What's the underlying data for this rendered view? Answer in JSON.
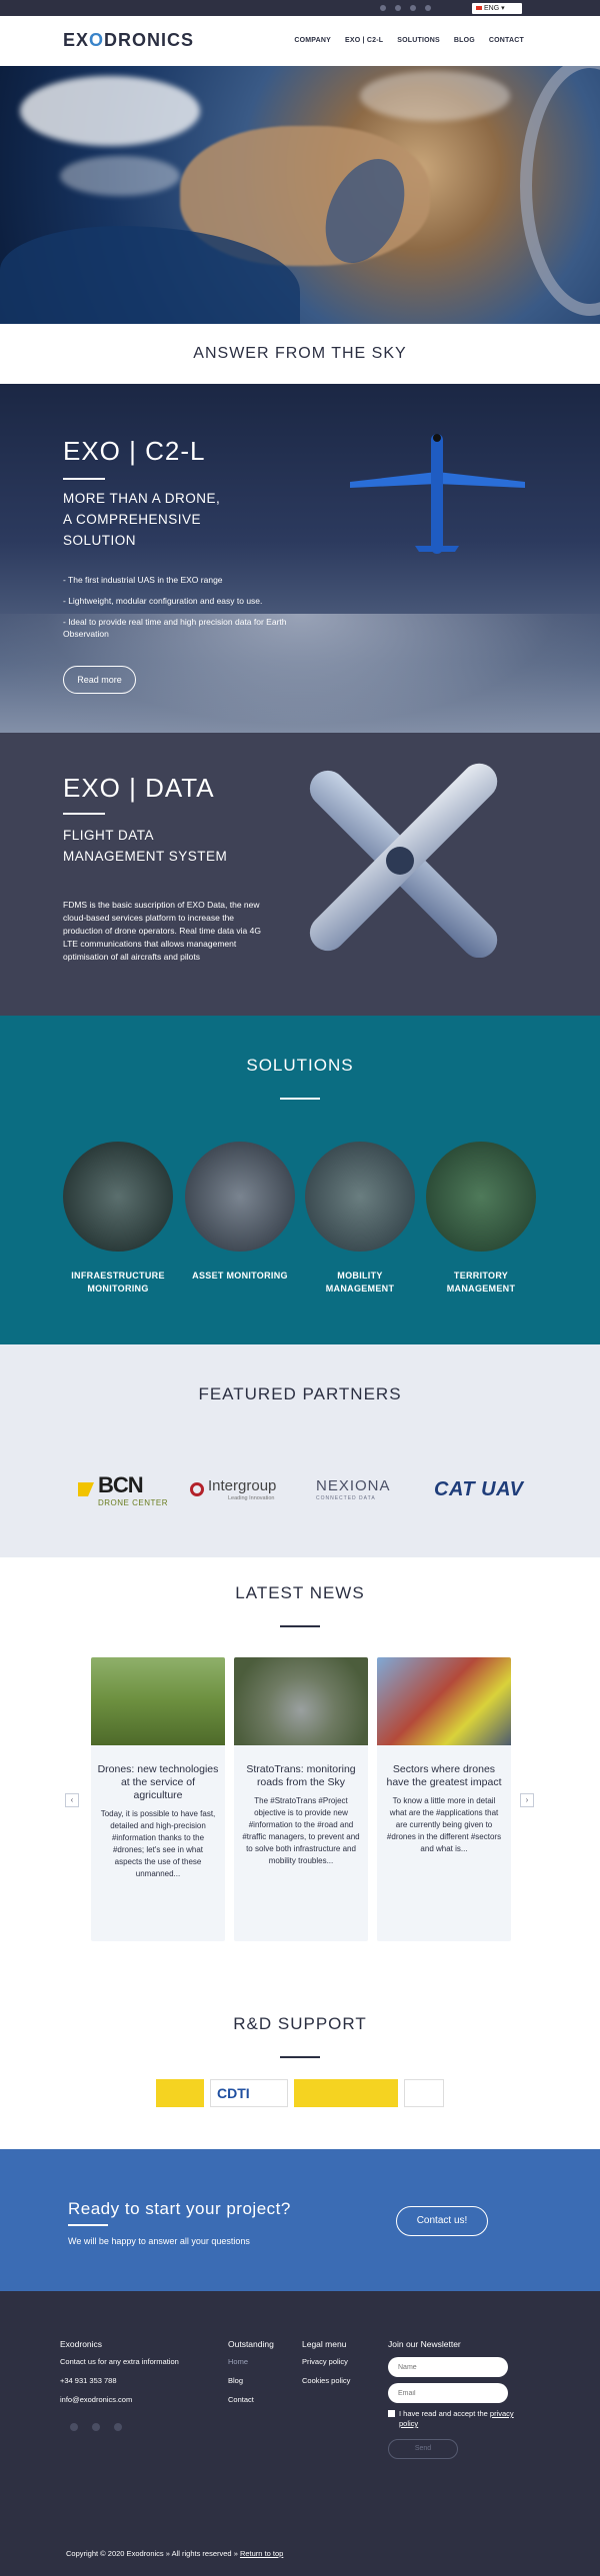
{
  "topbar": {
    "language": "ENG"
  },
  "header": {
    "logo": {
      "prefix": "EX",
      "o": "O",
      "suffix": "DRONICS"
    },
    "nav": [
      "COMPANY",
      "EXO | C2-L",
      "SOLUTIONS",
      "BLOG",
      "CONTACT"
    ]
  },
  "answer": {
    "title": "ANSWER FROM THE SKY"
  },
  "c2l": {
    "title": "EXO | C2-L",
    "subtitle_lines": [
      "MORE THAN A DRONE,",
      "A COMPREHENSIVE",
      "SOLUTION"
    ],
    "bullets": [
      "- The first industrial UAS in the EXO range",
      "- Lightweight, modular configuration and easy to use.",
      "- Ideal to provide real time and high precision data for Earth Observation"
    ],
    "button": "Read more"
  },
  "data": {
    "title": "EXO | DATA",
    "subtitle_lines": [
      "FLIGHT DATA",
      "MANAGEMENT SYSTEM"
    ],
    "body": "FDMS is the basic suscription of EXO Data, the new cloud-based services platform to increase the production of drone operators. Real time data via 4G LTE communications that allows management optimisation of all aircrafts and pilots"
  },
  "solutions": {
    "title": "SOLUTIONS",
    "items": [
      {
        "line1": "INFRAESTRUCTURE",
        "line2": "MONITORING"
      },
      {
        "line1": "ASSET MONITORING",
        "line2": ""
      },
      {
        "line1": "MOBILITY MANAGEMENT",
        "line2": ""
      },
      {
        "line1": "TERRITORY",
        "line2": "MANAGEMENT"
      }
    ]
  },
  "partners": {
    "title": "FEATURED PARTNERS",
    "bcn": {
      "big": "BCN",
      "small": "DRONE CENTER"
    },
    "intergroup": {
      "name": "Intergroup",
      "tag": "Leading Innovation"
    },
    "nexiona": {
      "name": "NEXIONA",
      "tag": "CONNECTED DATA"
    },
    "catuav": {
      "name": "CAT UAV"
    }
  },
  "news": {
    "title": "LATEST NEWS",
    "cards": [
      {
        "title": "Drones: new technologies at the service of agriculture",
        "excerpt": "Today, it is possible to have fast, detailed and high-precision #information thanks to the #drones; let's see in what aspects the use of these unmanned..."
      },
      {
        "title": "StratoTrans: monitoring roads from the Sky",
        "excerpt": "The #StratoTrans #Project objective is to provide new #information to the #road and #traffic managers, to prevent and to solve both infrastructure and mobility troubles..."
      },
      {
        "title": "Sectors where drones have the greatest impact",
        "excerpt": "To know a little more in detail what are the #applications that are currently being given to #drones in the different #sectors and what is..."
      }
    ]
  },
  "rd": {
    "title": "R&D SUPPORT",
    "cdti": "CDTI"
  },
  "cta": {
    "title": "Ready to start your project?",
    "text": "We will be happy to answer all your questions",
    "button": "Contact us!"
  },
  "footer": {
    "company": {
      "head": "Exodronics",
      "lines": [
        "Contact us for any extra information",
        "+34 931 353 788",
        "info@exodronics.com"
      ]
    },
    "outstanding": {
      "head": "Outstanding",
      "lines": [
        "Home",
        "Blog",
        "Contact"
      ]
    },
    "legal": {
      "head": "Legal menu",
      "lines": [
        "Privacy policy",
        "Cookies policy"
      ]
    },
    "newsletter": {
      "head": "Join our Newsletter",
      "name_placeholder": "Name",
      "email_placeholder": "Email",
      "consent_text": "I have read and accept the",
      "consent_link": "privacy policy",
      "send": "Send"
    },
    "copyright": "Copyright © 2020 Exodronics » All rights reserved »",
    "return": "Return to top"
  },
  "colors": {
    "brand": "#2b2f42",
    "accent": "#3a84c9",
    "teal": "#0b6d82",
    "cta": "#3b6cb4"
  }
}
